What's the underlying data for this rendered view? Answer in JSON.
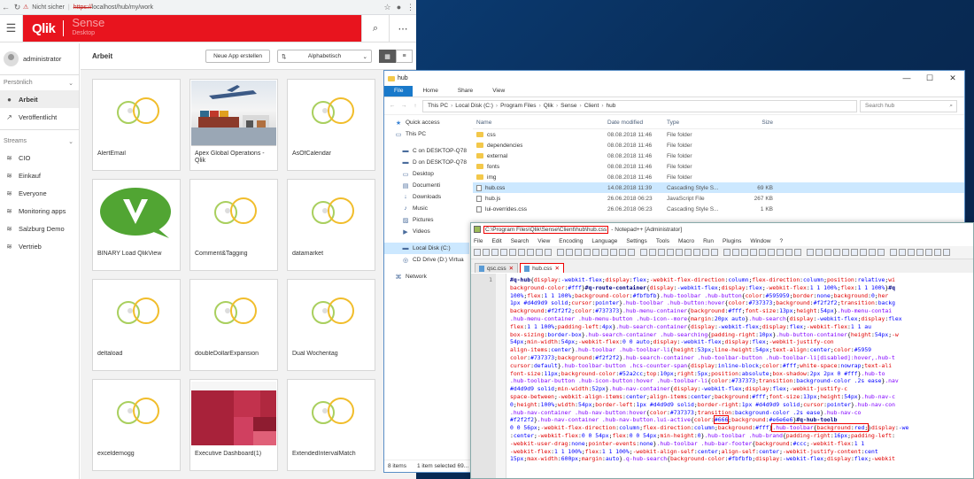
{
  "browser": {
    "security_label": "Nicht sicher",
    "url_scheme": "https://",
    "url_rest": "localhost/hub/my/work"
  },
  "hub": {
    "brand": "Qlik",
    "product": "Sense",
    "product_sub": "Desktop",
    "user": "administrator",
    "personal_label": "Persönlich",
    "streams_label": "Streams",
    "personal_items": [
      {
        "label": "Arbeit"
      },
      {
        "label": "Veröffentlicht"
      }
    ],
    "stream_items": [
      {
        "label": "CIO"
      },
      {
        "label": "Einkauf"
      },
      {
        "label": "Everyone"
      },
      {
        "label": "Monitoring apps"
      },
      {
        "label": "Salzburg Demo"
      },
      {
        "label": "Vertrieb"
      }
    ],
    "section_title": "Arbeit",
    "new_app_label": "Neue App erstellen",
    "sort_label": "Alphabetisch",
    "apps": [
      {
        "name": "AlertEmail",
        "thumb": "ring"
      },
      {
        "name": "Apex Global Operations - Qlik",
        "thumb": "photo"
      },
      {
        "name": "AsOfCalendar",
        "thumb": "ring"
      },
      {
        "name": "BINARY Load QlikView",
        "thumb": "qv"
      },
      {
        "name": "Comment&Tagging",
        "thumb": "ring"
      },
      {
        "name": "datamarket",
        "thumb": "ring"
      },
      {
        "name": "deltaload",
        "thumb": "ring"
      },
      {
        "name": "doubleDollarExpansion",
        "thumb": "ring"
      },
      {
        "name": "Dual Wochentag",
        "thumb": "ring"
      },
      {
        "name": "exceldemogg",
        "thumb": "ring"
      },
      {
        "name": "Executive Dashboard(1)",
        "thumb": "treemap"
      },
      {
        "name": "ExtendedIntervalMatch",
        "thumb": "ring"
      }
    ]
  },
  "explorer": {
    "title": "hub",
    "window_min": "—",
    "window_max": "☐",
    "window_close": "✕",
    "ribbon": [
      "File",
      "Home",
      "Share",
      "View"
    ],
    "breadcrumb": [
      "This PC",
      "Local Disk (C:)",
      "Program Files",
      "Qlik",
      "Sense",
      "Client",
      "hub"
    ],
    "search_placeholder": "Search hub",
    "tree": [
      {
        "label": "Quick access",
        "icon": "★"
      },
      {
        "label": "This PC",
        "icon": "▭"
      },
      {
        "label": "C on DESKTOP-Q78",
        "icon": "▬"
      },
      {
        "label": "D on DESKTOP-Q78",
        "icon": "▬"
      },
      {
        "label": "Desktop",
        "icon": "▭"
      },
      {
        "label": "Documenti",
        "icon": "▤"
      },
      {
        "label": "Downloads",
        "icon": "↓"
      },
      {
        "label": "Music",
        "icon": "♪"
      },
      {
        "label": "Pictures",
        "icon": "▨"
      },
      {
        "label": "Videos",
        "icon": "▶"
      },
      {
        "label": "Local Disk (C:)",
        "icon": "▬"
      },
      {
        "label": "CD Drive (D:) Virtua",
        "icon": "◎"
      },
      {
        "label": "Network",
        "icon": "⌘"
      }
    ],
    "columns": [
      "Name",
      "Date modified",
      "Type",
      "Size"
    ],
    "files": [
      {
        "name": "css",
        "date": "08.08.2018 11:46",
        "type": "File folder",
        "size": "",
        "folder": true
      },
      {
        "name": "dependencies",
        "date": "08.08.2018 11:46",
        "type": "File folder",
        "size": "",
        "folder": true
      },
      {
        "name": "external",
        "date": "08.08.2018 11:46",
        "type": "File folder",
        "size": "",
        "folder": true
      },
      {
        "name": "fonts",
        "date": "08.08.2018 11:46",
        "type": "File folder",
        "size": "",
        "folder": true
      },
      {
        "name": "img",
        "date": "08.08.2018 11:46",
        "type": "File folder",
        "size": "",
        "folder": true
      },
      {
        "name": "hub.css",
        "date": "14.08.2018 11:39",
        "type": "Cascading Style S...",
        "size": "69 KB",
        "folder": false
      },
      {
        "name": "hub.js",
        "date": "26.06.2018 06:23",
        "type": "JavaScript File",
        "size": "267 KB",
        "folder": false
      },
      {
        "name": "lui-overrides.css",
        "date": "26.06.2018 06:23",
        "type": "Cascading Style S...",
        "size": "1 KB",
        "folder": false
      }
    ],
    "status_items": "8 items",
    "status_selected": "1 item selected  69..."
  },
  "notepad": {
    "title_path": "C:\\Program Files\\Qlik\\Sense\\Client\\hub\\hub.css",
    "title_rest": "- Notepad++ [Administrator]",
    "menus": [
      "File",
      "Edit",
      "Search",
      "View",
      "Encoding",
      "Language",
      "Settings",
      "Tools",
      "Macro",
      "Run",
      "Plugins",
      "Window",
      "?"
    ],
    "tabs": [
      "qsc.css",
      "hub.css"
    ],
    "line_number": "1"
  }
}
